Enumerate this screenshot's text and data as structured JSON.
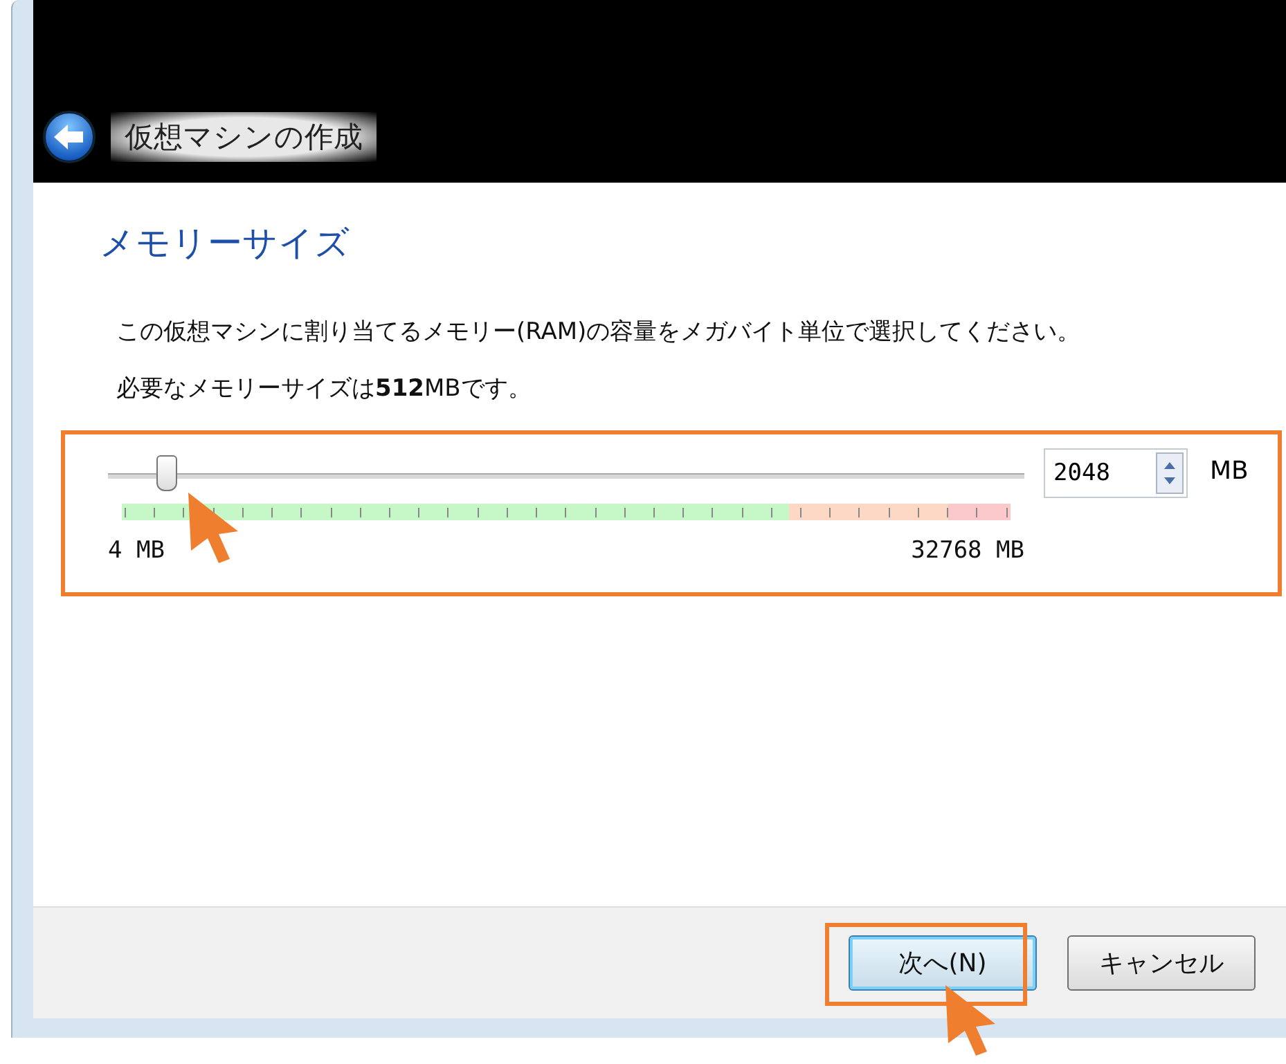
{
  "window": {
    "title": "仮想マシンの作成"
  },
  "heading": "メモリーサイズ",
  "description": "この仮想マシンに割り当てるメモリー(RAM)の容量をメガバイト単位で選択してください。",
  "recommendation": "必要なメモリーサイズは**512**MBです。",
  "memory": {
    "level": 0.0625,
    "min_label": "4 MB",
    "max_label": "32768 MB",
    "value": "2048",
    "unit": "MB"
  },
  "buttons": [
    {
      "label": "次へ(N)",
      "focused": true
    },
    {
      "label": "キャンセル",
      "focused": false
    }
  ]
}
